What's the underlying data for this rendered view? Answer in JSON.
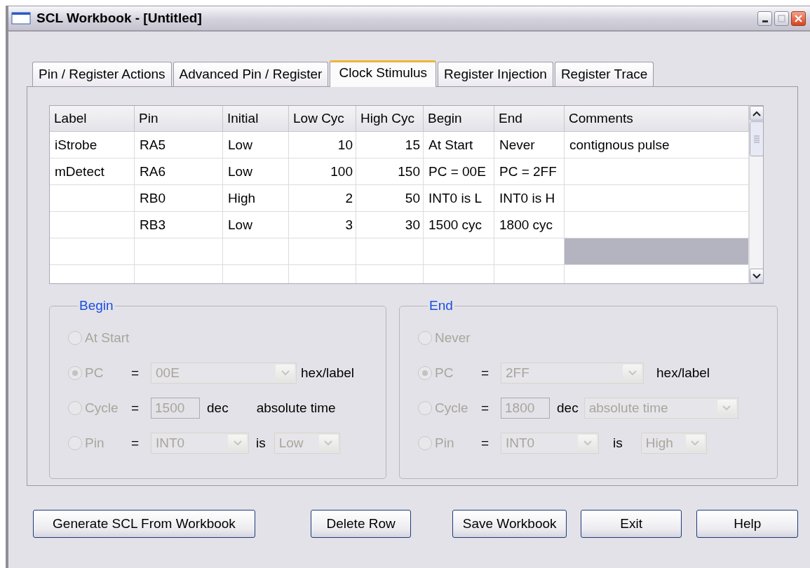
{
  "window": {
    "title": "SCL Workbook - [Untitled]"
  },
  "tabs": [
    {
      "label": "Pin / Register Actions",
      "selected": false
    },
    {
      "label": "Advanced Pin / Register",
      "selected": false
    },
    {
      "label": "Clock Stimulus",
      "selected": true
    },
    {
      "label": "Register Injection",
      "selected": false
    },
    {
      "label": "Register Trace",
      "selected": false
    }
  ],
  "table": {
    "columns": [
      "Label",
      "Pin",
      "Initial",
      "Low Cyc",
      "High Cyc",
      "Begin",
      "End",
      "Comments"
    ],
    "rows": [
      {
        "cells": [
          "iStrobe",
          "RA5",
          "Low",
          "10",
          "15",
          "At Start",
          "Never",
          "contignous pulse"
        ],
        "selected": false
      },
      {
        "cells": [
          "mDetect",
          "RA6",
          "Low",
          "100",
          "150",
          "PC = 00E",
          "PC = 2FF",
          null
        ],
        "selected": false
      },
      {
        "cells": [
          null,
          "RB0",
          "High",
          "2",
          "50",
          "INT0 is L",
          "INT0 is H",
          null
        ],
        "selected": false
      },
      {
        "cells": [
          null,
          "RB3",
          "Low",
          "3",
          "30",
          "1500 cyc",
          "1800 cyc",
          null
        ],
        "selected": false
      },
      {
        "cells": [
          null,
          null,
          null,
          null,
          null,
          null,
          null,
          null
        ],
        "selected": true
      },
      {
        "cells": [
          null,
          null,
          null,
          null,
          null,
          null,
          null,
          null
        ],
        "selected": false
      }
    ]
  },
  "groups": [
    {
      "title": "Begin",
      "disabled": true,
      "options": [
        {
          "kind": "plain",
          "label": "At Start",
          "selected": false
        },
        {
          "kind": "pc",
          "label": "PC",
          "eq": "=",
          "selected": true,
          "value": "00E",
          "suffix": "hex/label"
        },
        {
          "kind": "cycle",
          "label": "Cycle",
          "eq": "=",
          "selected": false,
          "value": "1500",
          "unit": "dec",
          "mode": "absolute time",
          "mode_dropdown": false
        },
        {
          "kind": "pin",
          "label": "Pin",
          "eq": "=",
          "selected": false,
          "value": "INT0",
          "is": "is",
          "state": "Low"
        }
      ]
    },
    {
      "title": "End",
      "disabled": true,
      "options": [
        {
          "kind": "plain",
          "label": "Never",
          "selected": false
        },
        {
          "kind": "pc",
          "label": "PC",
          "eq": "=",
          "selected": true,
          "value": "2FF",
          "suffix": "hex/label"
        },
        {
          "kind": "cycle",
          "label": "Cycle",
          "eq": "=",
          "selected": false,
          "value": "1800",
          "unit": "dec",
          "mode": "absolute time",
          "mode_dropdown": true
        },
        {
          "kind": "pin",
          "label": "Pin",
          "eq": "=",
          "selected": false,
          "value": "INT0",
          "is": "is",
          "state": "High"
        }
      ]
    }
  ],
  "buttons": [
    "Generate SCL From Workbook",
    "Delete Row",
    "Save Workbook",
    "Exit",
    "Help"
  ]
}
